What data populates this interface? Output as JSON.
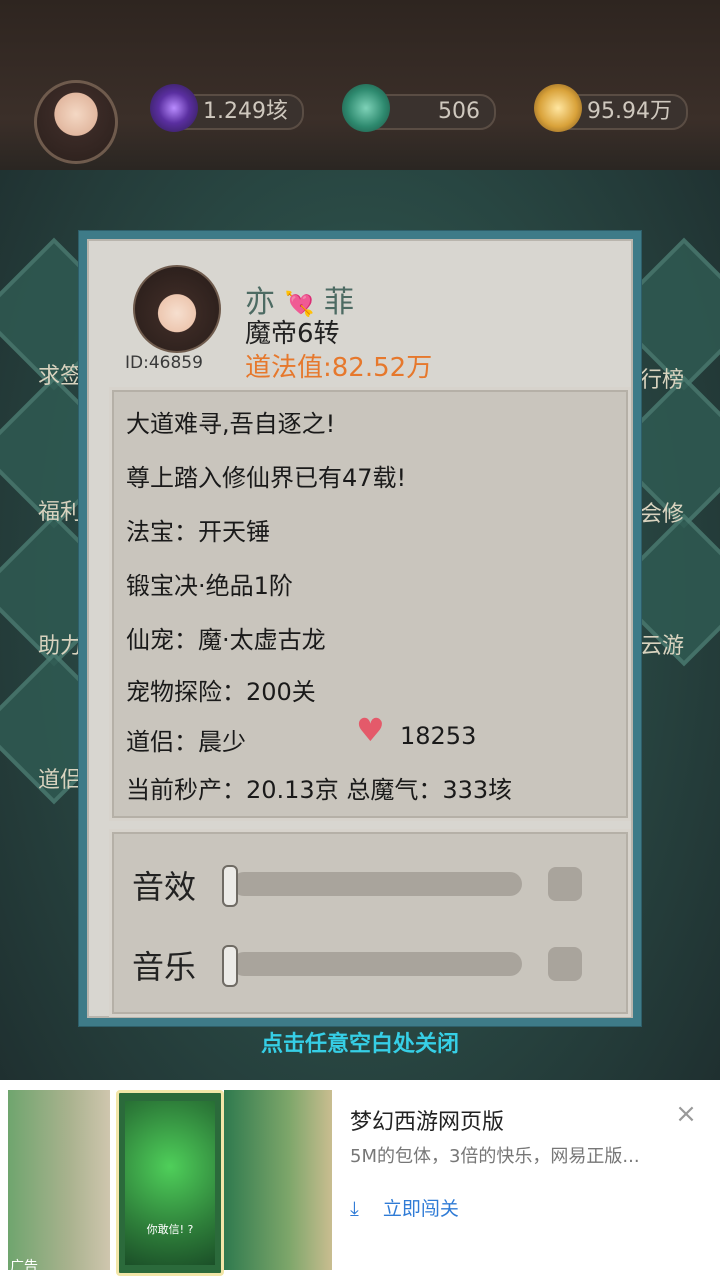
{
  "topbar": {
    "resources": [
      {
        "icon": "purple-orb-icon",
        "value": "1.249垓"
      },
      {
        "icon": "jade-icon",
        "value": "506"
      },
      {
        "icon": "gold-flower-icon",
        "value": "95.94万"
      }
    ]
  },
  "side": {
    "left": [
      "求签",
      "福利",
      "助力",
      "道侣"
    ],
    "right": [
      "行榜",
      "会修",
      "云游"
    ]
  },
  "profile": {
    "id_label": "ID:46859",
    "name_left": "亦",
    "name_heart": "💘",
    "name_right": "菲",
    "rank": "魔帝6转",
    "dao": "道法值:82.52万"
  },
  "info": {
    "motto": "大道难寻,吾自逐之!",
    "years": "尊上踏入修仙界已有47载!",
    "weapon": "法宝：开天锤",
    "forge": "锻宝决·绝品1阶",
    "pet": "仙宠：魔·太虚古龙",
    "pet_adventure": "宠物探险：200关",
    "partner": "道侣：晨少",
    "partner_value": "18253",
    "production": "当前秒产：20.13京  总魔气：333垓"
  },
  "settings": {
    "sound_label": "音效",
    "music_label": "音乐",
    "sound_level": 0,
    "music_level": 0
  },
  "close_tip": "点击任意空白处关闭",
  "ad": {
    "tag": "广告",
    "phone_text": "你敢信! ?",
    "title": "梦幻西游网页版",
    "desc": "5M的包体，3倍的快乐，网易正版...",
    "cta_icon": "download-icon",
    "cta": "立即闯关",
    "close": "×"
  }
}
